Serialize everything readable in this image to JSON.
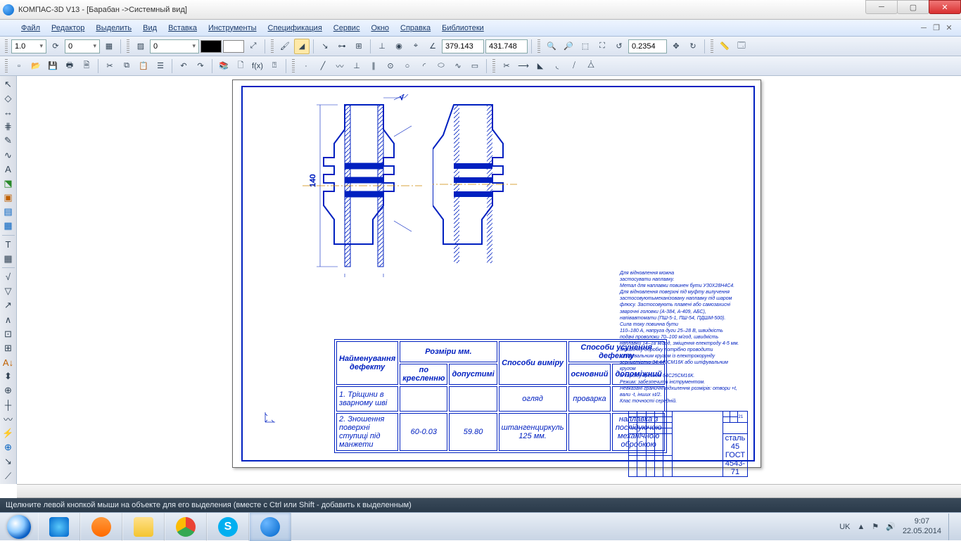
{
  "title": "КОМПАС-3D V13 - [Барабан ->Системный вид]",
  "menu": [
    "Файл",
    "Редактор",
    "Выделить",
    "Вид",
    "Вставка",
    "Инструменты",
    "Спецификация",
    "Сервис",
    "Окно",
    "Справка",
    "Библиотеки"
  ],
  "tb1": {
    "scale": "1.0",
    "step": "0",
    "combo": "0",
    "coord_x": "379.143",
    "coord_y": "431.748",
    "zoom": "0.2354"
  },
  "status": "Щелкните левой кнопкой мыши на объекте для его выделения (вместе с Ctrl или Shift - добавить к выделенным)",
  "tray": {
    "lang": "UK",
    "time": "9:07",
    "date": "22.05.2014"
  },
  "defect_table": {
    "h1": "Найменування дефекту",
    "h2": "Розміри мм.",
    "h2a": "по кресленню",
    "h2b": "допустимі",
    "h3": "Способи виміру",
    "h4": "Способи усунення дефекту",
    "h4a": "основний",
    "h4b": "допоміжний",
    "r1_name": "1. Тріщини в зварному шві",
    "r1_method": "огляд",
    "r1_main": "проварка",
    "r2_name": "2. Зношення поверхні ступиці під манжети",
    "r2_draw": "60-0.03",
    "r2_allow": "59.80",
    "r2_method": "штангенциркуль 125 мм.",
    "r2_aux": "наплавка з послідуючою механічною обробкою"
  },
  "notes": "Для відновлення можна\nзастосувати наплавку.\nМетал для наплавки повинен бути У30Х28Н4С4.\nДля відновлення поверхні під муфту вилучення\nзастосовуютьмеханізовану наплавку під шаром\nфлюсу. Застосовують плавені або самозахисні\nзварочні головки (А-384, А-409, АБС),\nнапівавтомати (ПШ-5-1, ПШ-54, ПДШМ-500).\nСила току повинна бути\n110–180 А, напруга дуги 25–28 В, швидкість\nподачі проволоки 70–100 м/год, швидкість\nнаплавки 14–18 м/год, зміщення електроду 4-5 мм.\nМеханічну обробку потрібно проводити\nшліфувальним кругом із електрокорунду\nзернистістю 34.440СМ16К або шліфувальним кругом\nіз карбіду кремнію 64С25СМ16К.\nРежим: забезпечити інструментом.\nНевказані граничні відхилення розмірів: отвори +t,\nвали -t, інших ±t/2.\nКлас точності середній.",
  "stamp": {
    "mat": "сталь 45",
    "gost": "ГОСТ 4543-71",
    "sheet": "21"
  }
}
